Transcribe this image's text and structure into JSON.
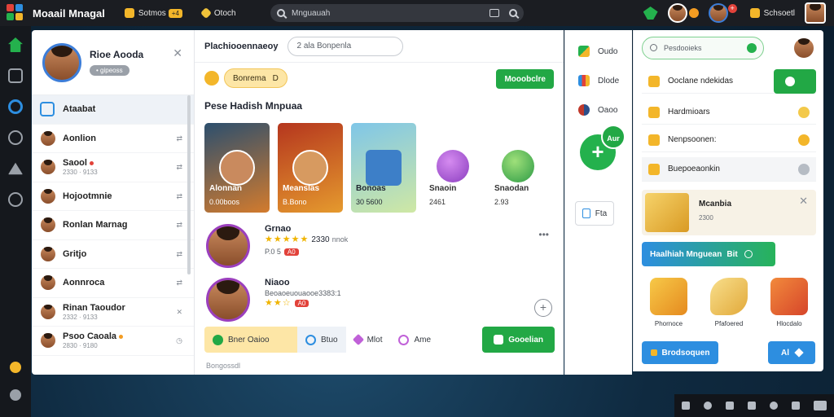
{
  "topbar": {
    "app_title": "Moaail Mnagal",
    "chip1_label": "Sotmos",
    "chip1_badge": "+4",
    "chip2_label": "Otoch",
    "search_placeholder": "Mnguauah",
    "right_label": "Schsoetl",
    "avatar_badge": "+"
  },
  "left": {
    "profile_name": "Rioe Aooda",
    "profile_sub": "• gipeoss",
    "contacts": [
      {
        "name": "Ataabat",
        "sub": "",
        "action": ""
      },
      {
        "name": "Aonlion",
        "sub": "",
        "action": "⇄"
      },
      {
        "name": "Saool",
        "sub": "2330 · 9133",
        "action": "⇄"
      },
      {
        "name": "Hojootmnie",
        "sub": "",
        "action": "⇄"
      },
      {
        "name": "Ronlan Marnag",
        "sub": "",
        "action": "⇄"
      },
      {
        "name": "Gritjo",
        "sub": "",
        "action": "⇄"
      },
      {
        "name": "Aonnroca",
        "sub": "",
        "action": "⇄"
      },
      {
        "name": "Rinan Taoudor",
        "sub": "2332 · 9133",
        "action": "✕"
      },
      {
        "name": "Psoo Caoala",
        "sub": "2830 · 9180",
        "action": "◷"
      }
    ]
  },
  "main": {
    "header_title": "Plachiooennaeoy",
    "header_input": "2 ala Bonpenla",
    "filter_pill": "Bonrema",
    "filter_pill_icon": "D",
    "filter_button": "Mooobclre",
    "section_title": "Pese Hadish Mnpuaa",
    "cards": [
      {
        "title": "Alonnan",
        "sub": "0.00boos"
      },
      {
        "title": "Meanslas",
        "sub": "B.Bono"
      },
      {
        "title": "Bonoas",
        "sub": "30 5600"
      },
      {
        "title": "Snaoin",
        "sub": "2461"
      },
      {
        "title": "Snaodan",
        "sub": "2.93"
      }
    ],
    "feed": [
      {
        "name": "Grnao",
        "stars": "★★★★★",
        "rating": "2330",
        "meta_suffix": "nnok",
        "meta": "P.0  5",
        "badge": "A0"
      },
      {
        "name": "Niaoo",
        "stars": "★★☆",
        "rating": "",
        "meta_suffix": "",
        "meta": "Beoaoeuouaooe3383:1",
        "badge": "A0"
      }
    ],
    "actions": [
      {
        "label": "Bner Oaioo"
      },
      {
        "label": "Btuo"
      },
      {
        "label": "Mlot"
      },
      {
        "label": "Ame"
      }
    ],
    "action_green": "Gooelian",
    "footer": "Bongossdl"
  },
  "mid": {
    "rows": [
      "Oudo",
      "Dlode",
      "Oaoo"
    ],
    "fab_badge": "Aur",
    "chip": "Fta"
  },
  "right": {
    "search_placeholder": "Pesdooieks",
    "rows": [
      "Ooclane ndekidas",
      "Hardmioars",
      "Nenpsoonen:",
      "Buepoeaonkin"
    ],
    "promo_title": "Mcanbia",
    "promo_sub": "2300",
    "banner": "Haalhiah Mnguean",
    "banner_suffix": "Bit",
    "gifts": [
      "Phornoce",
      "Pfafoered",
      "Hlocdalo"
    ],
    "btn_left": "Brodsoquen",
    "btn_right": "Al"
  }
}
